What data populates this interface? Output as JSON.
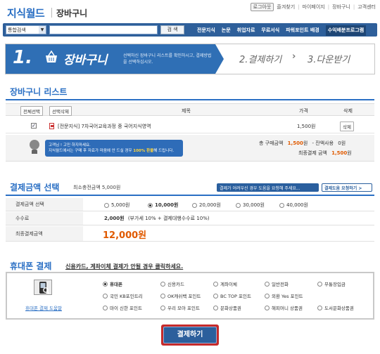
{
  "header": {
    "logo": "지식월드",
    "subtitle": "장바구니",
    "top_links": [
      "로그아웃",
      "즐겨찾기",
      "마이페이지",
      "장바구니",
      "고객센터"
    ]
  },
  "search": {
    "category": "통합검색",
    "button": "검 색"
  },
  "nav": [
    "전문지식",
    "논문",
    "취업자료",
    "무료서식",
    "파워포인트 배경",
    "수익배분프로그램"
  ],
  "steps": {
    "step1_num": "1.",
    "step1_label": "장바구니",
    "step1_desc": "선택하신 장바구니 리스트를 확인하시고, 결제방법을 선택하십시오.",
    "step2": "2.결제하기",
    "arrow": "›",
    "step3": "3.다운받기"
  },
  "cart": {
    "title": "장바구니 리스트",
    "select_all": "전체선택",
    "delete_selected": "선택삭제",
    "col_title": "제목",
    "col_price": "가격",
    "col_delete": "삭제",
    "item": {
      "checked": true,
      "title": "[전문지식] 7차국어교육과정 중 국어지식영역",
      "price": "1,500원",
      "delete_label": "삭제"
    },
    "notice_line1": "고객님 ! 고민 하지마세요.",
    "notice_line2a": "지식월드에서는 구매 후 자료가 마음에 안 드실 경우 ",
    "notice_highlight": "100% 환불",
    "notice_line2b": "해 드립니다.",
    "total_label": "총 구매금액",
    "total_value": "1,500",
    "won": "원",
    "points_label": "- 잔액사용",
    "points_value": "0원",
    "final_label": "최종결제 금액",
    "final_value": "1,500"
  },
  "payment": {
    "title": "결제금액 선택",
    "min_label": "최소충전금액 5,000원",
    "help1": "결제가 어려우신 경우 도움을 요청해 주세요...",
    "help2": "결제도움 요청하기 >",
    "amount_label": "결제금액 선택",
    "amounts": [
      "5,000원",
      "10,000원",
      "20,000원",
      "30,000원",
      "40,000원"
    ],
    "selected_index": 1,
    "fee_label": "수수료",
    "fee_value": "2,000원",
    "fee_note": "(부가세 10% + 결제대행수수료 10%)",
    "final_label": "최종결제금액",
    "final_value": "12,000원"
  },
  "phone": {
    "title": "휴대폰 결제",
    "subtitle": "신용카드, 계좌이체 결제가 안될 경우 클릭하세요.",
    "help_link": "휴대폰 결제 도움말",
    "methods": [
      [
        "휴대폰",
        "신용카드",
        "계좌이체",
        "일반전화",
        "무통장입금"
      ],
      [
        "국민 KB포인트리",
        "OK캐쉬백 포인트",
        "BC TOP 포인트",
        "외환 Yes 포인트",
        ""
      ],
      [
        "마이 신한 포인트",
        "우리 모아 포인트",
        "문화상품권",
        "해피머니 상품권",
        "도서문화상품권"
      ]
    ],
    "selected": "휴대폰"
  },
  "submit": "결제하기",
  "colors": {
    "brand_blue": "#2a6fc4",
    "nav_blue": "#2e5f9a",
    "price_orange": "#e05a00",
    "submit_border": "#c62a2a"
  }
}
